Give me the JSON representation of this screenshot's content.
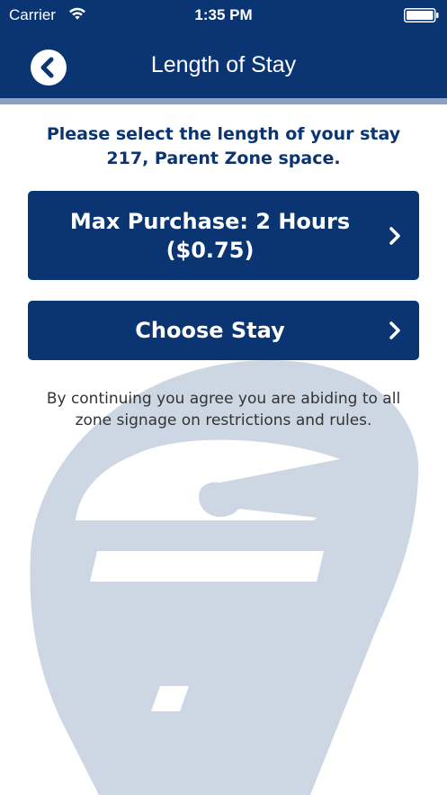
{
  "status_bar": {
    "carrier": "Carrier",
    "time": "1:35 PM",
    "wifi_icon": "wifi-icon",
    "battery_icon": "battery-icon"
  },
  "nav": {
    "title": "Length of Stay",
    "back_icon": "chevron-left-icon"
  },
  "instructions": {
    "line1": "Please select the length of your stay",
    "line2": "217, Parent Zone space."
  },
  "options": [
    {
      "label_line1": "Max Purchase: 2 Hours",
      "label_line2": "($0.75)",
      "icon": "chevron-right-icon"
    },
    {
      "label": "Choose Stay",
      "icon": "chevron-right-icon"
    }
  ],
  "disclaimer": {
    "line1": "By continuing you agree you are abiding to all",
    "line2": "zone signage on restrictions and rules."
  },
  "colors": {
    "primary": "#0a3572",
    "accent_bar": "#8da1bf",
    "watermark": "#cdd6e3",
    "background": "#ffffff"
  }
}
